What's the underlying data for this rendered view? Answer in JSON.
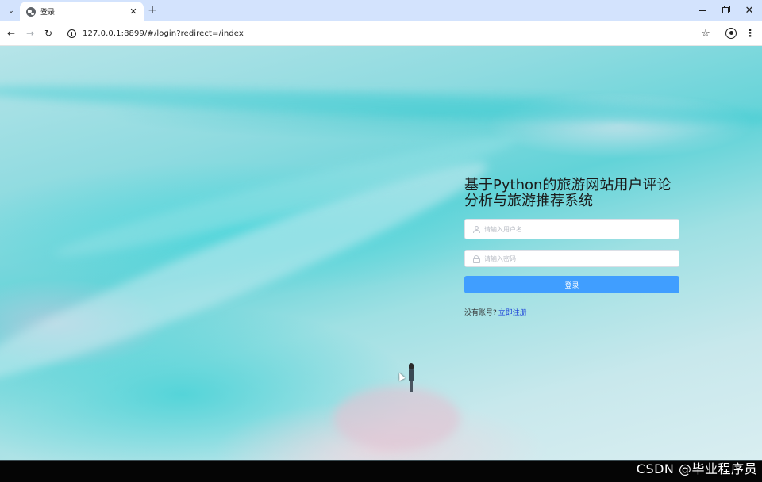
{
  "browser": {
    "tab": {
      "title": "登录",
      "close_glyph": "✕"
    },
    "new_tab_glyph": "+",
    "tab_search_glyph": "⌄",
    "window": {
      "close_glyph": "✕"
    },
    "nav": {
      "back_glyph": "←",
      "forward_glyph": "→",
      "reload_glyph": "↻"
    },
    "address": {
      "info_glyph": "i",
      "url": "127.0.0.1:8899/#/login?redirect=/index"
    },
    "bookmark_glyph": "☆",
    "menu_glyph": "⋮"
  },
  "login": {
    "title": "基于Python的旅游网站用户评论分析与旅游推荐系统",
    "username_placeholder": "请输入用户名",
    "password_placeholder": "请输入密码",
    "submit_label": "登录",
    "register_prompt": "没有账号?",
    "register_link": "立即注册"
  },
  "watermark": "CSDN @毕业程序员",
  "colors": {
    "tabbar": "#d3e3fd",
    "primary_button": "#409eff",
    "link": "#1a3fd9"
  },
  "icons": [
    "tab-search-icon",
    "globe-icon",
    "close-icon",
    "plus-icon",
    "minimize-icon",
    "maximize-icon",
    "back-arrow-icon",
    "forward-arrow-icon",
    "reload-icon",
    "info-icon",
    "star-icon",
    "profile-icon",
    "kebab-menu-icon",
    "user-icon",
    "lock-icon"
  ]
}
